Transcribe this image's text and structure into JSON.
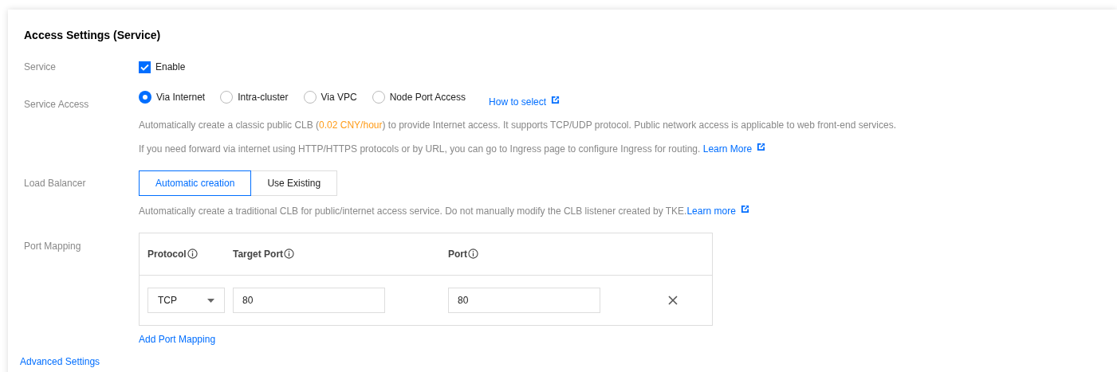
{
  "section_title": "Access Settings (Service)",
  "service": {
    "label": "Service",
    "checkbox_label": "Enable",
    "checked": true
  },
  "service_access": {
    "label": "Service Access",
    "options": [
      {
        "label": "Via Internet",
        "selected": true
      },
      {
        "label": "Intra-cluster",
        "selected": false
      },
      {
        "label": "Via VPC",
        "selected": false
      },
      {
        "label": "Node Port Access",
        "selected": false
      }
    ],
    "help_link": "How to select",
    "description": "Automatically create a classic public CLB (",
    "price": "0.02 CNY/hour",
    "description_end": ") to provide Internet access. It supports TCP/UDP protocol. Public network access is applicable to web front-end services.",
    "note": "If you need forward via internet using HTTP/HTTPS protocols or by URL, you can go to Ingress page to configure Ingress for routing.",
    "note_link": "Learn More"
  },
  "load_balancer": {
    "label": "Load Balancer",
    "options": [
      {
        "label": "Automatic creation",
        "selected": true
      },
      {
        "label": "Use Existing",
        "selected": false
      }
    ],
    "description": "Automatically create a traditional CLB for public/internet access service. Do not manually modify the CLB listener created by TKE.",
    "link": "Learn more"
  },
  "port_mapping": {
    "label": "Port Mapping",
    "columns": [
      "Protocol",
      "Target Port",
      "Port"
    ],
    "rows": [
      {
        "protocol": "TCP",
        "target_port": "80",
        "port": "80"
      }
    ],
    "add_link": "Add Port Mapping"
  },
  "advanced_link": "Advanced Settings"
}
